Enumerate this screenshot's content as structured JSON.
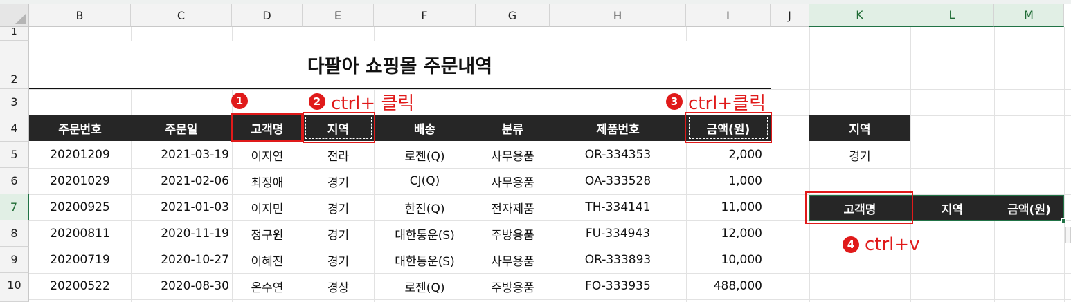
{
  "columns": [
    "B",
    "C",
    "D",
    "E",
    "F",
    "G",
    "H",
    "I",
    "J",
    "K",
    "L",
    "M"
  ],
  "rows": [
    "1",
    "2",
    "3",
    "4",
    "5",
    "6",
    "7",
    "8",
    "9",
    "10"
  ],
  "sheet_title": "다팔아 쇼핑몰 주문내역",
  "headers": [
    "주문번호",
    "주문일",
    "고객명",
    "지역",
    "배송",
    "분류",
    "제품번호",
    "금액(원)"
  ],
  "data_rows": [
    [
      "20201209",
      "2021-03-19",
      "이지연",
      "전라",
      "로젠(Q)",
      "사무용품",
      "OR-334353",
      "2,000"
    ],
    [
      "20201029",
      "2021-02-06",
      "최정애",
      "경기",
      "CJ(Q)",
      "사무용품",
      "OA-333528",
      "1,000"
    ],
    [
      "20200925",
      "2021-01-03",
      "이지민",
      "경기",
      "한진(Q)",
      "전자제품",
      "TH-334141",
      "11,000"
    ],
    [
      "20200811",
      "2020-11-19",
      "정구원",
      "경기",
      "대한통운(S)",
      "주방용품",
      "FU-334943",
      "12,000"
    ],
    [
      "20200719",
      "2020-10-27",
      "이혜진",
      "경기",
      "대한통운(S)",
      "사무용품",
      "OR-333893",
      "10,000"
    ],
    [
      "20200522",
      "2020-08-30",
      "온수연",
      "경상",
      "로젠(Q)",
      "주방용품",
      "FO-333935",
      "488,000"
    ]
  ],
  "criteria": {
    "header": "지역",
    "value": "경기"
  },
  "pasted_headers": [
    "고객명",
    "지역",
    "금액(원)"
  ],
  "annotations": {
    "step1": {
      "badge": "1",
      "text": ""
    },
    "step2": {
      "badge": "2",
      "text": "ctrl+ 클릭"
    },
    "step3": {
      "badge": "3",
      "text": "ctrl+클릭"
    },
    "step4": {
      "badge": "4",
      "text": "ctrl+v"
    }
  },
  "colors": {
    "accent_red": "#e01a1a",
    "header_bg": "#262626",
    "excel_green": "#217346"
  }
}
